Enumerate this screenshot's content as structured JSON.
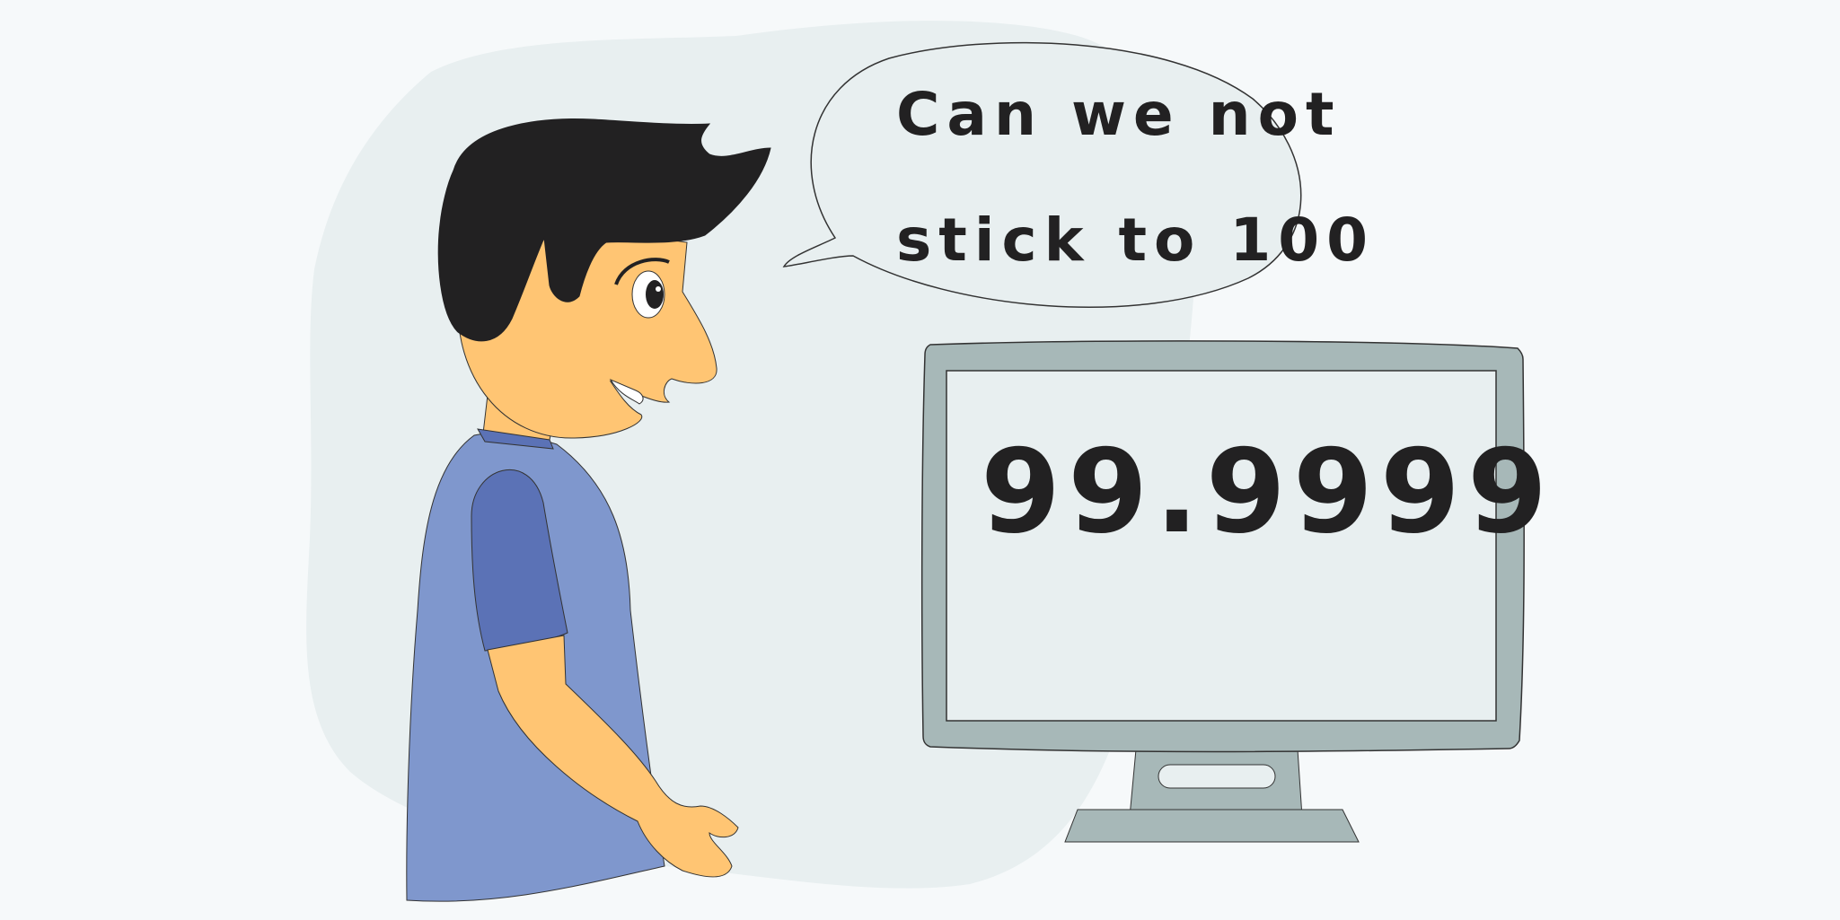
{
  "speech_bubble": {
    "line1": "Can we not",
    "line2": "stick to 100"
  },
  "monitor": {
    "display_value": "99.9999"
  },
  "colors": {
    "background": "#f6f9fa",
    "blob": "#e8eff0",
    "skin": "#ffc573",
    "hair": "#222122",
    "shirt": "#7f97cd",
    "sleeve": "#5b72b6",
    "monitor_frame": "#a7b8b8",
    "screen": "#e8eff0"
  }
}
